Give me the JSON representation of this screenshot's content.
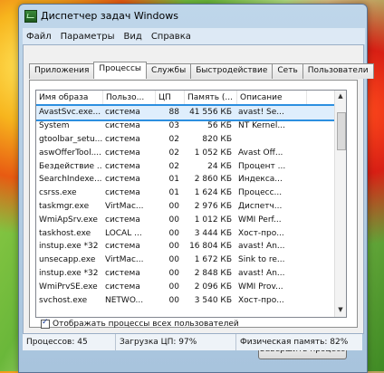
{
  "window": {
    "title": "Диспетчер задач Windows"
  },
  "menu": [
    "Файл",
    "Параметры",
    "Вид",
    "Справка"
  ],
  "tabs": [
    "Приложения",
    "Процессы",
    "Службы",
    "Быстродействие",
    "Сеть",
    "Пользователи"
  ],
  "active_tab_index": 1,
  "columns": [
    "Имя образа",
    "Пользо...",
    "ЦП",
    "Память (...",
    "Описание"
  ],
  "rows": [
    [
      "AvastSvc.exe...",
      "система",
      "88",
      "41 556 КБ",
      "avast! Se..."
    ],
    [
      "System",
      "система",
      "03",
      "56 КБ",
      "NT Kernel..."
    ],
    [
      "gtoolbar_setu...",
      "система",
      "02",
      "820 КБ",
      ""
    ],
    [
      "aswOfferTool....",
      "система",
      "02",
      "1 052 КБ",
      "Avast Off..."
    ],
    [
      "Бездействие ...",
      "система",
      "02",
      "24 КБ",
      "Процент ..."
    ],
    [
      "SearchIndexe...",
      "система",
      "01",
      "2 860 КБ",
      "Индекса..."
    ],
    [
      "csrss.exe",
      "система",
      "01",
      "1 624 КБ",
      "Процесс..."
    ],
    [
      "taskmgr.exe",
      "VirtMac...",
      "00",
      "2 976 КБ",
      "Диспетч..."
    ],
    [
      "WmiApSrv.exe",
      "система",
      "00",
      "1 012 КБ",
      "WMI Perf..."
    ],
    [
      "taskhost.exe",
      "LOCAL ...",
      "00",
      "3 444 КБ",
      "Хост-про..."
    ],
    [
      "instup.exe *32",
      "система",
      "00",
      "16 804 КБ",
      "avast! An..."
    ],
    [
      "unsecapp.exe",
      "VirtMac...",
      "00",
      "1 672 КБ",
      "Sink to re..."
    ],
    [
      "instup.exe *32",
      "система",
      "00",
      "2 848 КБ",
      "avast! An..."
    ],
    [
      "WmiPrvSE.exe",
      "система",
      "00",
      "2 096 КБ",
      "WMI Prov..."
    ],
    [
      "svchost.exe",
      "NETWO...",
      "00",
      "3 540 КБ",
      "Хост-про..."
    ]
  ],
  "selected_row": 0,
  "show_all_users": {
    "label": "Отображать процессы всех пользователей",
    "checked": true
  },
  "end_process_label": "Завершить процесс",
  "status": {
    "processes": "Процессов: 45",
    "cpu": "Загрузка ЦП: 97%",
    "memory": "Физическая память: 82%"
  }
}
